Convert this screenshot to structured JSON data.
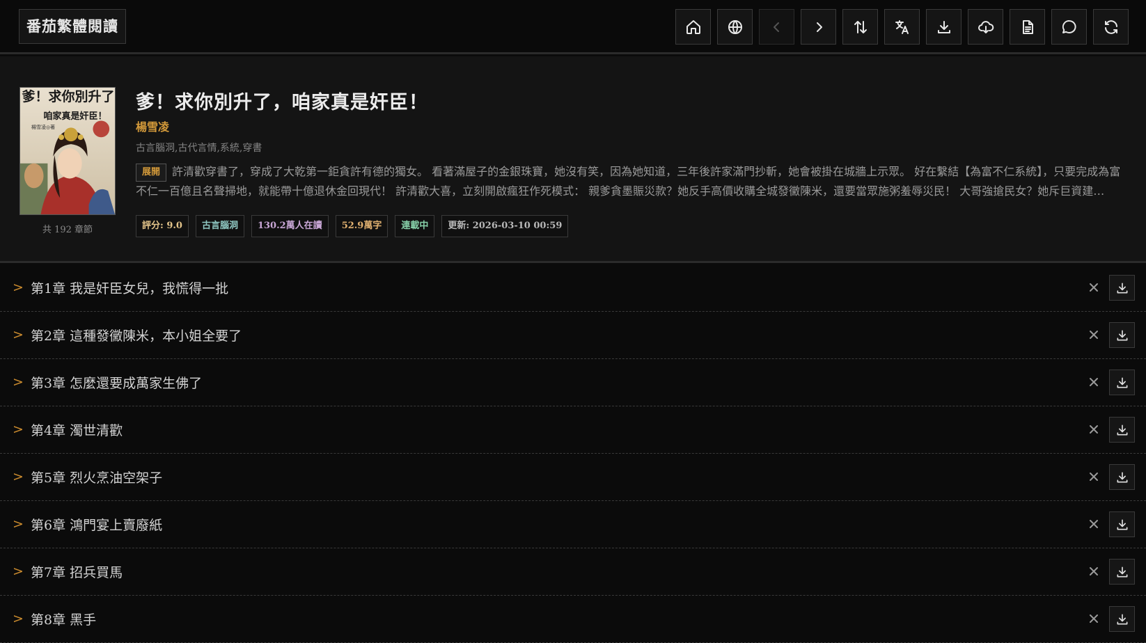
{
  "app": {
    "brand": "番茄繁體閱讀"
  },
  "toolbar": [
    {
      "icon": "home-icon",
      "name": "home-button",
      "disabled": false
    },
    {
      "icon": "globe-icon",
      "name": "language-button",
      "disabled": false
    },
    {
      "icon": "chevron-left-icon",
      "name": "prev-button",
      "disabled": true
    },
    {
      "icon": "chevron-right-icon",
      "name": "next-button",
      "disabled": false
    },
    {
      "icon": "sort-icon",
      "name": "sort-button",
      "disabled": false
    },
    {
      "icon": "translate-icon",
      "name": "translate-button",
      "disabled": false
    },
    {
      "icon": "download-icon",
      "name": "download-button",
      "disabled": false
    },
    {
      "icon": "cloud-download-icon",
      "name": "cloud-download-button",
      "disabled": false
    },
    {
      "icon": "document-icon",
      "name": "document-button",
      "disabled": false
    },
    {
      "icon": "comment-icon",
      "name": "comment-button",
      "disabled": false
    },
    {
      "icon": "refresh-icon",
      "name": "refresh-button",
      "disabled": false
    }
  ],
  "book": {
    "title": "爹！求你別升了，咱家真是奸臣！",
    "author": "楊雪凌",
    "genres": "古言腦洞,古代言情,系統,穿書",
    "expand_label": "展開",
    "description": "許清歡穿書了，穿成了大乾第一鉅貪許有德的獨女。 看著滿屋子的金銀珠寶，她沒有笑，因為她知道，三年後許家滿門抄斬，她會被掛在城牆上示眾。 好在繫結【為富不仁系統】，只要完成為富不仁一百億且名聲掃地，就能帶十億退休金回現代！ 許清歡大喜，立刻開啟瘋狂作死模式： 親爹貪墨賑災款？她反手高價收購全城發黴陳米，還要當眾施粥羞辱災民！ 大哥強搶民女？她斥巨資建…",
    "chapter_count": "共 192 章節",
    "cover": {
      "line1": "爹！求你別升了",
      "line2": "咱家真是奸臣！",
      "line3": "楊雪凌◎著"
    },
    "tags": [
      {
        "text": "評分: 9.0",
        "color": "#e3c48a"
      },
      {
        "text": "古言腦洞",
        "color": "#8fc7c2"
      },
      {
        "text": "130.2萬人在讀",
        "color": "#c9a7d6"
      },
      {
        "text": "52.9萬字",
        "color": "#e0b070"
      },
      {
        "text": "連載中",
        "color": "#86cfa8"
      },
      {
        "text": "更新: 2026-03-10 00:59",
        "color": "#b8b8b8"
      }
    ]
  },
  "chapters": [
    {
      "title": "第1章 我是奸臣女兒，我慌得一批"
    },
    {
      "title": "第2章 這種發黴陳米，本小姐全要了"
    },
    {
      "title": "第3章 怎麼還要成萬家生佛了"
    },
    {
      "title": "第4章 濁世清歡"
    },
    {
      "title": "第5章 烈火烹油空架子"
    },
    {
      "title": "第6章 鴻門宴上賣廢紙"
    },
    {
      "title": "第7章 招兵買馬"
    },
    {
      "title": "第8章 黑手"
    }
  ],
  "chapter_actions": {
    "chevron": ">"
  }
}
